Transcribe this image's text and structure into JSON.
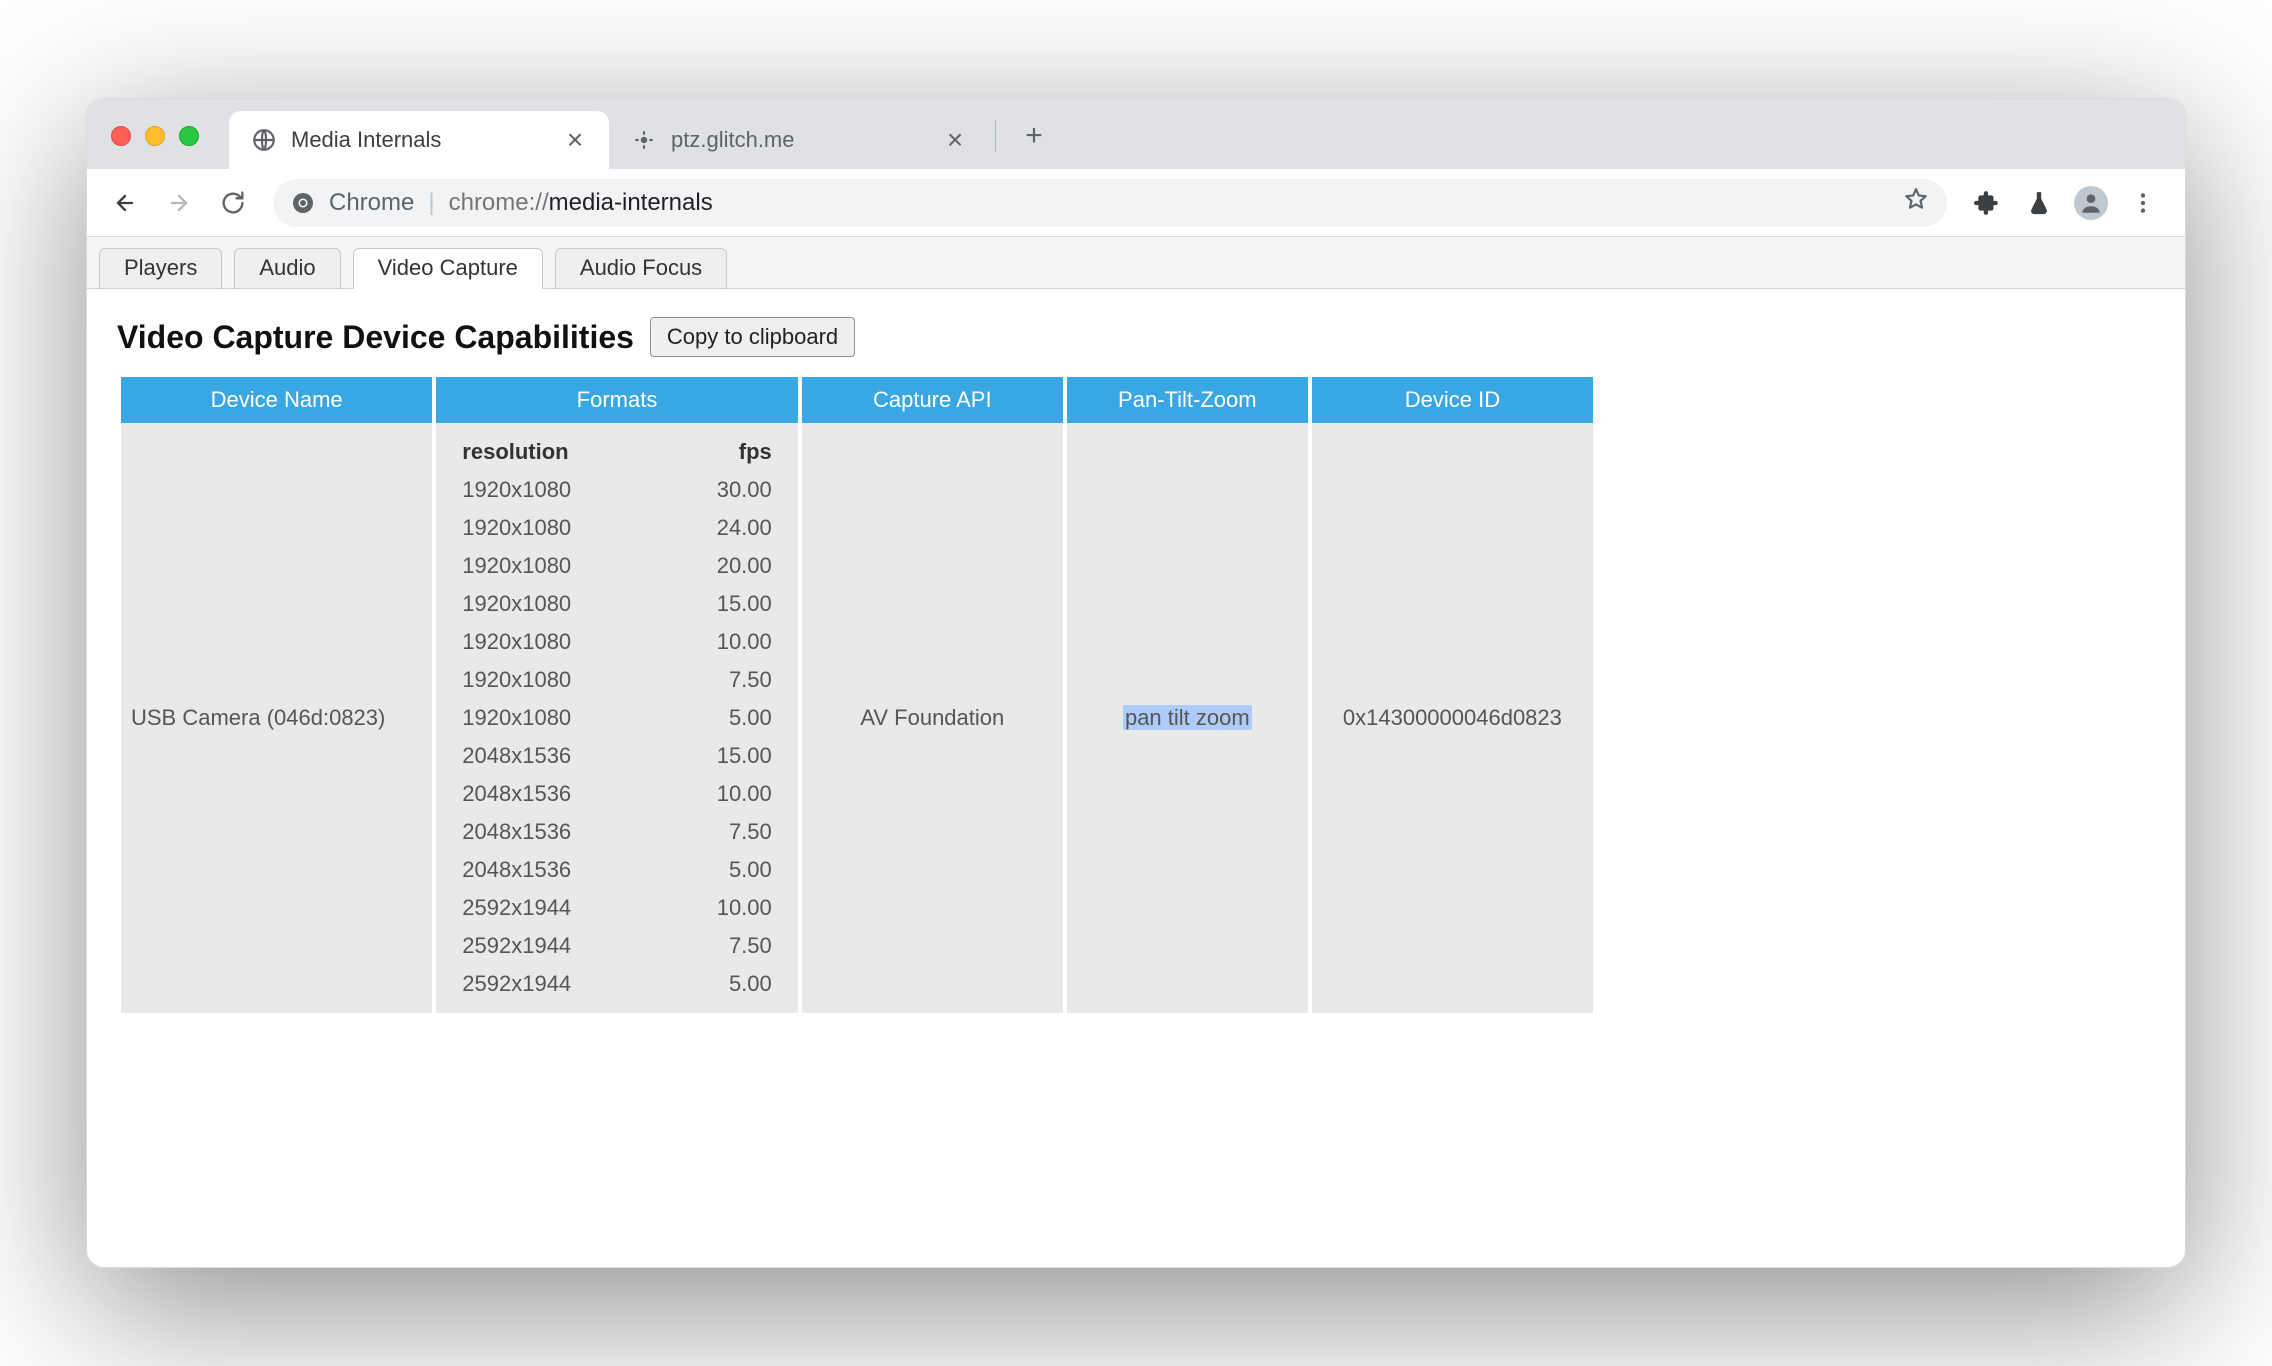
{
  "browser": {
    "tabs": [
      {
        "title": "Media Internals",
        "active": true
      },
      {
        "title": "ptz.glitch.me",
        "active": false
      }
    ]
  },
  "omnibox": {
    "scheme": "Chrome",
    "url_dim": "chrome://",
    "url_bold": "media-internals"
  },
  "subtabs": [
    {
      "label": "Players",
      "active": false
    },
    {
      "label": "Audio",
      "active": false
    },
    {
      "label": "Video Capture",
      "active": true
    },
    {
      "label": "Audio Focus",
      "active": false
    }
  ],
  "heading": "Video Capture Device Capabilities",
  "copy_label": "Copy to clipboard",
  "table": {
    "headers": [
      "Device Name",
      "Formats",
      "Capture API",
      "Pan-Tilt-Zoom",
      "Device ID"
    ],
    "row": {
      "device_name": "USB Camera (046d:0823)",
      "capture_api": "AV Foundation",
      "ptz": "pan tilt zoom",
      "device_id": "0x14300000046d0823",
      "formats_header": {
        "resolution": "resolution",
        "fps": "fps"
      },
      "formats": [
        {
          "resolution": "1920x1080",
          "fps": "30.00"
        },
        {
          "resolution": "1920x1080",
          "fps": "24.00"
        },
        {
          "resolution": "1920x1080",
          "fps": "20.00"
        },
        {
          "resolution": "1920x1080",
          "fps": "15.00"
        },
        {
          "resolution": "1920x1080",
          "fps": "10.00"
        },
        {
          "resolution": "1920x1080",
          "fps": "7.50"
        },
        {
          "resolution": "1920x1080",
          "fps": "5.00"
        },
        {
          "resolution": "2048x1536",
          "fps": "15.00"
        },
        {
          "resolution": "2048x1536",
          "fps": "10.00"
        },
        {
          "resolution": "2048x1536",
          "fps": "7.50"
        },
        {
          "resolution": "2048x1536",
          "fps": "5.00"
        },
        {
          "resolution": "2592x1944",
          "fps": "10.00"
        },
        {
          "resolution": "2592x1944",
          "fps": "7.50"
        },
        {
          "resolution": "2592x1944",
          "fps": "5.00"
        }
      ]
    }
  }
}
